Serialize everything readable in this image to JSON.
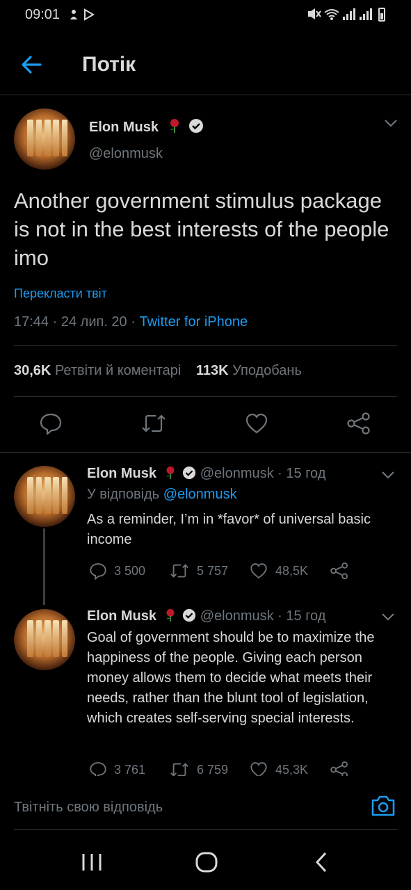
{
  "status_bar": {
    "time": "09:01"
  },
  "header": {
    "title": "Потік"
  },
  "main_tweet": {
    "name": "Elon Musk",
    "handle": "@elonmusk",
    "text": "Another government stimulus package is not in the best interests of the people imo",
    "translate_label": "Перекласти твіт",
    "time": "17:44",
    "date": "24 лип. 20",
    "source": "Twitter for iPhone",
    "retweets_count": "30,6K",
    "retweets_label": "Ретвіти й коментарі",
    "likes_count": "113K",
    "likes_label": "Уподобань"
  },
  "replies": [
    {
      "name": "Elon Musk",
      "handle": "@elonmusk",
      "time": "· 15 год",
      "replying_to_label": "У відповідь",
      "replying_to_handle": "@elonmusk",
      "text": "As a reminder, I’m in *favor* of universal basic income",
      "comments": "3 500",
      "retweets": "5 757",
      "likes": "48,5K"
    },
    {
      "name": "Elon Musk",
      "handle": "@elonmusk",
      "time": "· 15 год",
      "text": "Goal of government should be to maximize the happiness of the people. Giving each person money allows them to decide what meets their needs, rather than the blunt tool of legislation, which creates self-serving special interests.",
      "comments": "3 761",
      "retweets": "6 759",
      "likes": "45,3K"
    }
  ],
  "reply_box": {
    "placeholder": "Твітніть свою відповідь"
  },
  "colors": {
    "background": "#000000",
    "text": "#d9d9d9",
    "muted": "#6e767d",
    "accent": "#1d9bf0",
    "rose": "#c0182b"
  },
  "icons": [
    "back-arrow-icon",
    "rose-emoji-icon",
    "verified-badge-icon",
    "chevron-down-icon",
    "comment-icon",
    "retweet-icon",
    "heart-icon",
    "share-icon",
    "camera-icon",
    "recent-apps-icon",
    "home-icon",
    "back-nav-icon"
  ]
}
